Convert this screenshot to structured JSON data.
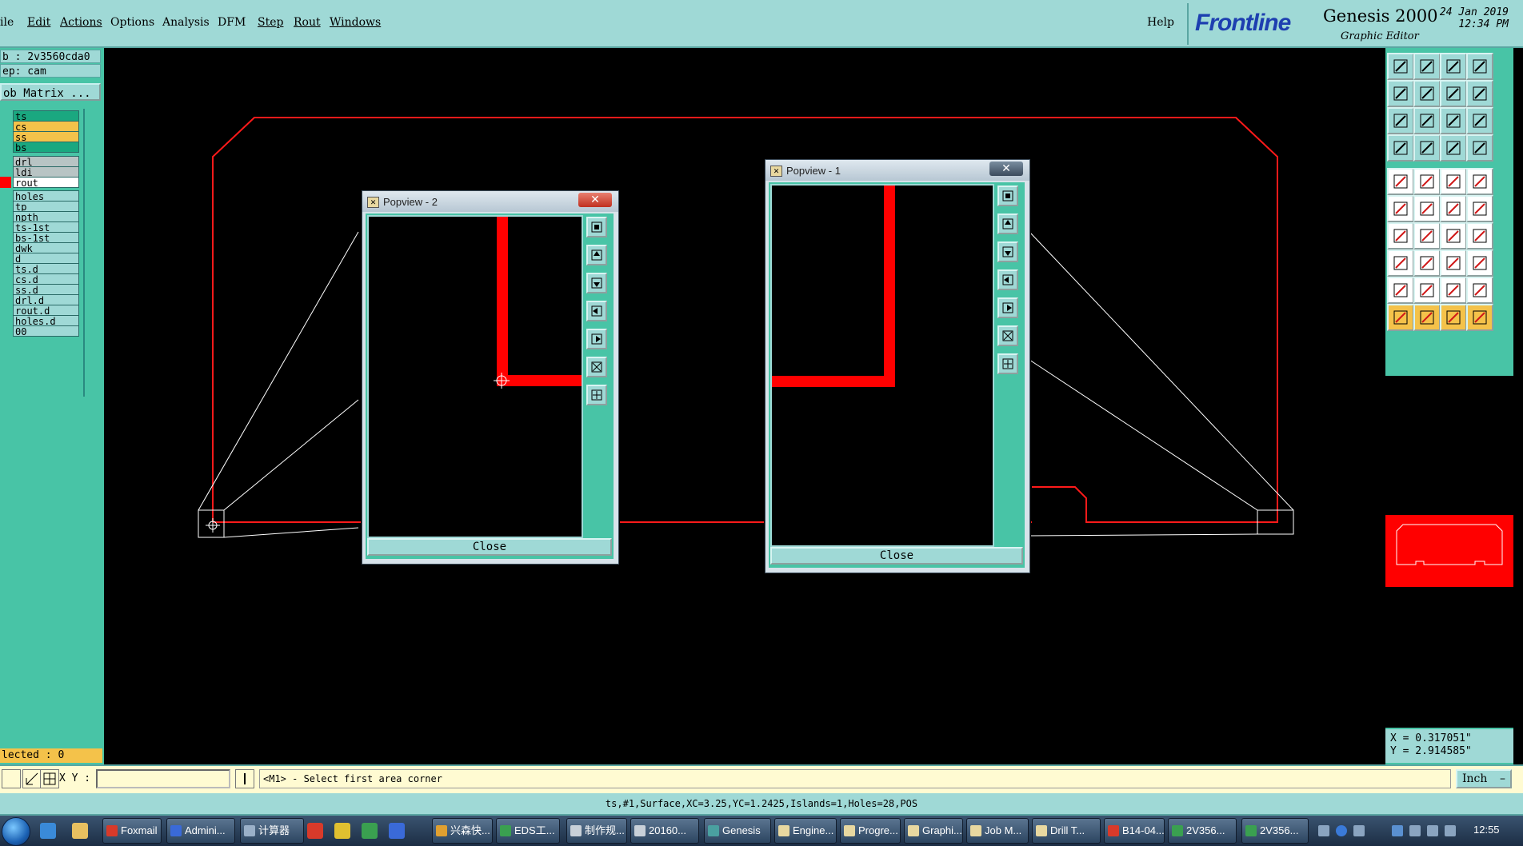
{
  "menubar": {
    "items": [
      "ile",
      "Edit",
      "Actions",
      "Options",
      "Analysis",
      "DFM",
      "Step",
      "Rout",
      "Windows"
    ],
    "help": "Help"
  },
  "brand": {
    "logo": "Frontline",
    "product": "Genesis 2000",
    "subtitle": "Graphic Editor",
    "date_line1": "24 Jan 2019",
    "date_line2": "12:34 PM"
  },
  "left_panel": {
    "job": "b : 2v3560cda0",
    "step": "ep: cam",
    "job_matrix": "ob Matrix ...",
    "selected": "lected : 0",
    "layers": [
      {
        "name": "ts",
        "color": "#1aa880"
      },
      {
        "name": "cs",
        "color": "#f4c24a"
      },
      {
        "name": "ss",
        "color": "#f4c24a"
      },
      {
        "name": "bs",
        "color": "#1aa880"
      },
      {
        "name": "drl",
        "color": "#b8c4c4"
      },
      {
        "name": "ldi",
        "color": "#b8c4c4"
      },
      {
        "name": "rout",
        "color": "#ffffff",
        "marker": "#ff0000"
      },
      {
        "name": "holes",
        "color": "#9fd9d6"
      },
      {
        "name": "tp",
        "color": "#9fd9d6"
      },
      {
        "name": "npth",
        "color": "#9fd9d6"
      },
      {
        "name": "ts-1st",
        "color": "#9fd9d6"
      },
      {
        "name": "bs-1st",
        "color": "#9fd9d6"
      },
      {
        "name": "dwk",
        "color": "#9fd9d6"
      },
      {
        "name": "d",
        "color": "#9fd9d6"
      },
      {
        "name": "ts.d",
        "color": "#9fd9d6"
      },
      {
        "name": "cs.d",
        "color": "#9fd9d6"
      },
      {
        "name": "ss.d",
        "color": "#9fd9d6"
      },
      {
        "name": "drl.d",
        "color": "#9fd9d6"
      },
      {
        "name": "rout.d",
        "color": "#9fd9d6"
      },
      {
        "name": "holes.d",
        "color": "#9fd9d6"
      },
      {
        "name": "00",
        "color": "#9fd9d6"
      }
    ]
  },
  "popview2": {
    "title": "Popview - 2",
    "close_label": "Close"
  },
  "popview1": {
    "title": "Popview - 1",
    "close_label": "Close"
  },
  "coords": {
    "x": "X = 0.317051\"",
    "y": "Y = 2.914585\""
  },
  "command": {
    "xy_label": "X Y :",
    "xy_value": "",
    "prompt": "<M1> - Select first area corner",
    "units": "Inch"
  },
  "status": "ts,#1,Surface,XC=3.25,YC=1.2425,Islands=1,Holes=28,POS",
  "taskbar": {
    "tasks": [
      {
        "label": "Foxmail",
        "icon_color": "#d83a2a"
      },
      {
        "label": "Admini...",
        "icon_color": "#3a6ad8"
      },
      {
        "label": "计算器",
        "icon_color": "#9ab0c8"
      },
      {
        "label": "兴森快...",
        "icon_color": "#e0a030"
      },
      {
        "label": "EDS工...",
        "icon_color": "#3aa050"
      },
      {
        "label": "制作规...",
        "icon_color": "#c8d0d8"
      },
      {
        "label": "20160...",
        "icon_color": "#c8d0d8"
      },
      {
        "label": "Genesis",
        "icon_color": "#4aa0a0"
      },
      {
        "label": "Engine...",
        "icon_color": "#e8d8a0"
      },
      {
        "label": "Progre...",
        "icon_color": "#e8d8a0"
      },
      {
        "label": "Graphi...",
        "icon_color": "#e8d8a0"
      },
      {
        "label": "Job M...",
        "icon_color": "#e8d8a0"
      },
      {
        "label": "Drill T...",
        "icon_color": "#e8d8a0"
      },
      {
        "label": "B14-04...",
        "icon_color": "#d83a2a"
      },
      {
        "label": "2V356...",
        "icon_color": "#3aa050"
      },
      {
        "label": "2V356...",
        "icon_color": "#3aa050"
      }
    ],
    "clock": "12:55"
  }
}
